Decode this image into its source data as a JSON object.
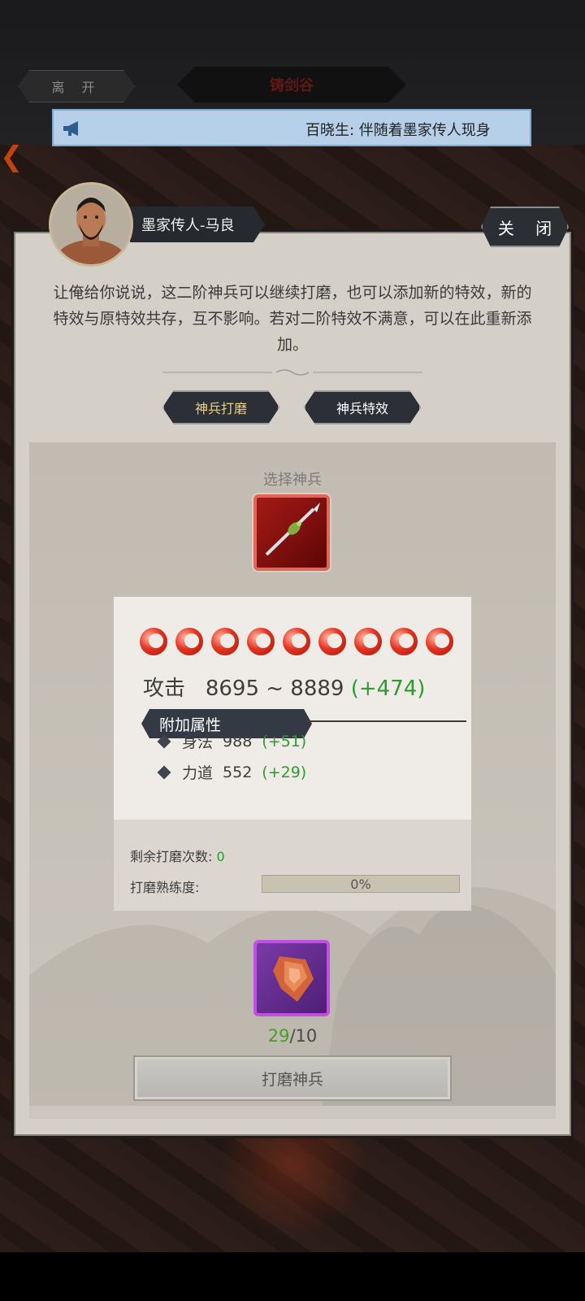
{
  "top_bar": {
    "leave_label": "离 开",
    "location_title": "铸剑谷",
    "news_text": "百晓生: 伴随着墨家传人现身"
  },
  "dialog": {
    "npc_name": "墨家传人-马良",
    "close_label": "关 闭",
    "intro_text": "让俺给你说说，这二阶神兵可以继续打磨，也可以添加新的特效，新的特效与原特效共存，互不影响。若对二阶特效不满意，可以在此重新添加。",
    "tabs": [
      {
        "label": "神兵打磨",
        "active": true
      },
      {
        "label": "神兵特效",
        "active": false
      }
    ]
  },
  "weapon": {
    "select_label": "选择神兵",
    "star_count": 9,
    "attack_label": "攻击",
    "attack_range": "8695 ~ 8889",
    "attack_bonus": "(+474)",
    "extra_header": "附加属性",
    "attributes": [
      {
        "name": "身法",
        "value": "988",
        "bonus": "(+51)"
      },
      {
        "name": "力道",
        "value": "552",
        "bonus": "(+29)"
      }
    ],
    "remaining_label": "剩余打磨次数:",
    "remaining_value": "0",
    "proficiency_label": "打磨熟练度:",
    "proficiency_text": "0%",
    "proficiency_fraction": 0
  },
  "material": {
    "owned": "29",
    "required": "/10",
    "polish_button": "打磨神兵"
  },
  "colors": {
    "bonus_green": "#2f9a2f",
    "weapon_slot_red": "#a61a16",
    "stone_slot_purple": "#7a3aa8",
    "news_blue": "#b7d0e9"
  }
}
